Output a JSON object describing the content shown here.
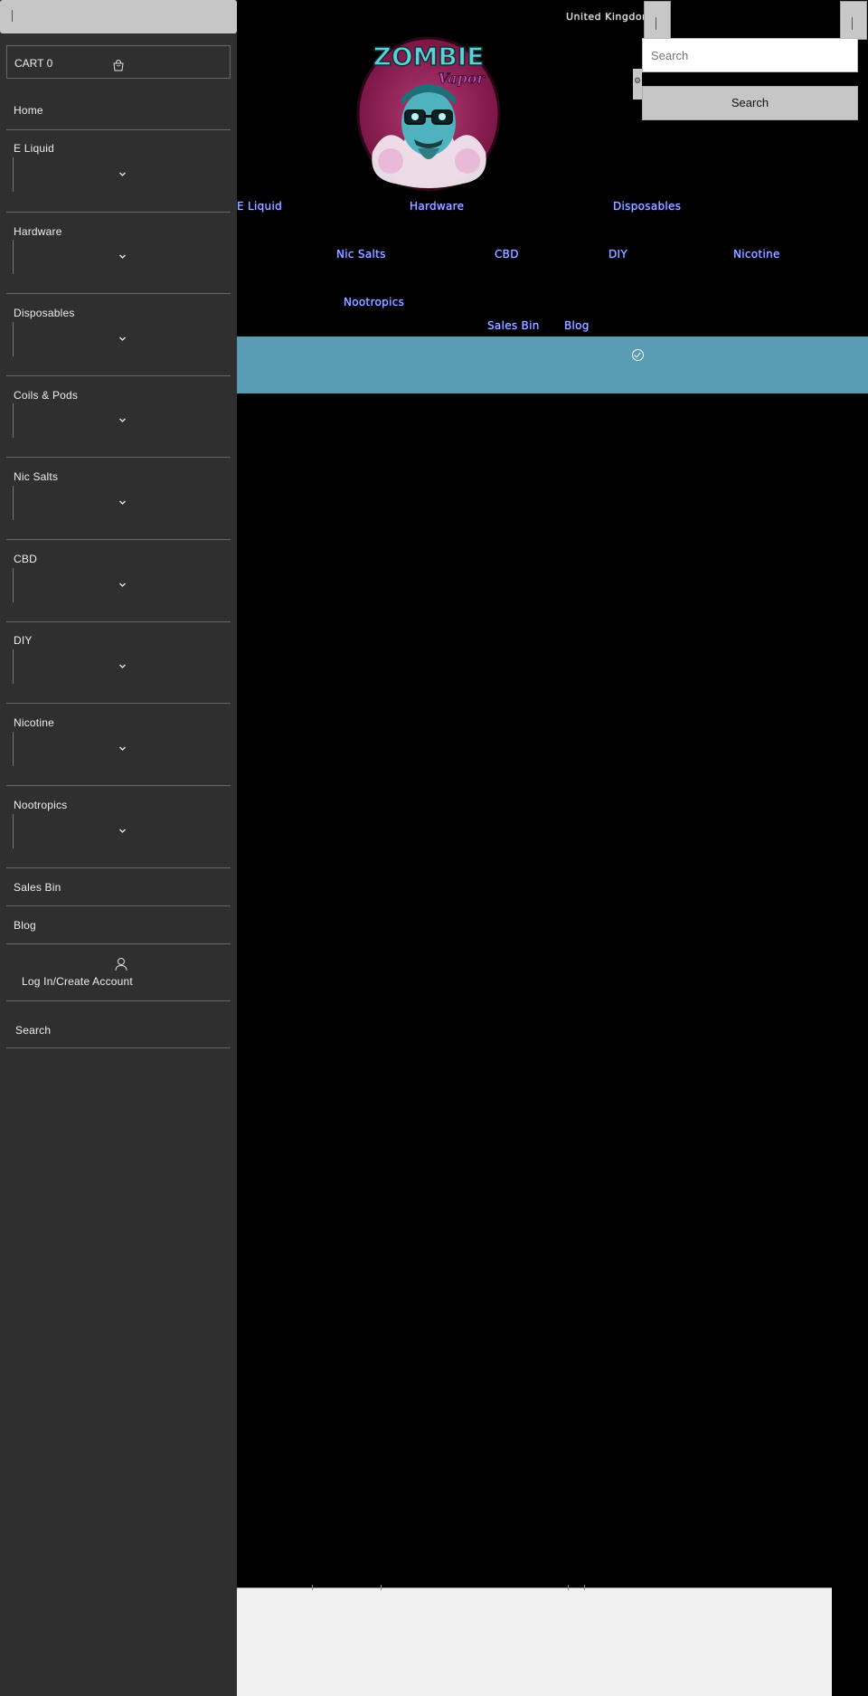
{
  "header": {
    "country_selector": "United Kingdom (G",
    "search_placeholder": "Search",
    "search_button": "Search",
    "logo": {
      "title": "ZOMBIE",
      "subtitle": "Vapor"
    }
  },
  "nav": {
    "items": [
      {
        "label": "E Liquid"
      },
      {
        "label": "Hardware"
      },
      {
        "label": "Disposables"
      },
      {
        "label": "Nic Salts"
      },
      {
        "label": "CBD"
      },
      {
        "label": "DIY"
      },
      {
        "label": "Nicotine"
      },
      {
        "label": "Nootropics"
      },
      {
        "label": "Sales Bin"
      },
      {
        "label": "Blog"
      }
    ]
  },
  "drawer": {
    "cart_label": "CART 0",
    "menu": [
      {
        "label": "Home",
        "has_dropdown": false
      },
      {
        "label": "E Liquid",
        "has_dropdown": true
      },
      {
        "label": "Hardware",
        "has_dropdown": true
      },
      {
        "label": "Disposables",
        "has_dropdown": true
      },
      {
        "label": "Coils & Pods",
        "has_dropdown": true
      },
      {
        "label": "Nic Salts",
        "has_dropdown": true
      },
      {
        "label": "CBD",
        "has_dropdown": true
      },
      {
        "label": "DIY",
        "has_dropdown": true
      },
      {
        "label": "Nicotine",
        "has_dropdown": true
      },
      {
        "label": "Nootropics",
        "has_dropdown": true
      },
      {
        "label": "Sales Bin",
        "has_dropdown": false
      },
      {
        "label": "Blog",
        "has_dropdown": false
      }
    ],
    "account_label": "Log In/Create Account",
    "search_label": "Search"
  },
  "colors": {
    "drawer_bg": "#2f2f2f",
    "banner": "#5a9bb4",
    "nav_link": "#a9b8ff",
    "page_bg": "#000000"
  }
}
